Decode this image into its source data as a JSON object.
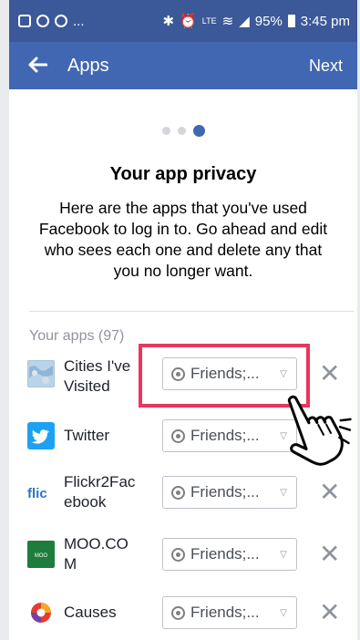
{
  "status_bar": {
    "battery": "95%",
    "time": "3:45 pm",
    "overflow": "..."
  },
  "nav": {
    "back_icon": "back-arrow-icon",
    "title": "Apps",
    "next_label": "Next"
  },
  "pager": {
    "total": 3,
    "active_index": 2
  },
  "privacy": {
    "title": "Your app privacy",
    "description": "Here are the apps that you've used Facebook to log in to. Go ahead and edit who sees each one and delete any that you no longer want."
  },
  "apps_section": {
    "label": "Your apps (97)"
  },
  "apps": [
    {
      "name": "Cities I've Visited",
      "audience": "Friends;...",
      "icon": "cities-map-icon",
      "remove": "✕"
    },
    {
      "name": "Twitter",
      "audience": "Friends;...",
      "icon": "twitter-bird-icon",
      "remove": "✕"
    },
    {
      "name": "Flickr2Facebook",
      "audience": "Friends;...",
      "icon": "flickr-icon",
      "remove": "✕"
    },
    {
      "name": "MOO.COM",
      "audience": "Friends;...",
      "icon": "moo-icon",
      "remove": "✕"
    },
    {
      "name": "Causes",
      "audience": "Friends;...",
      "icon": "causes-icon",
      "remove": "✕"
    }
  ],
  "colors": {
    "status_bar": "#3b5998",
    "nav_bar": "#4267b2",
    "highlight": "#e8365d",
    "pager_active": "#4267b2"
  }
}
